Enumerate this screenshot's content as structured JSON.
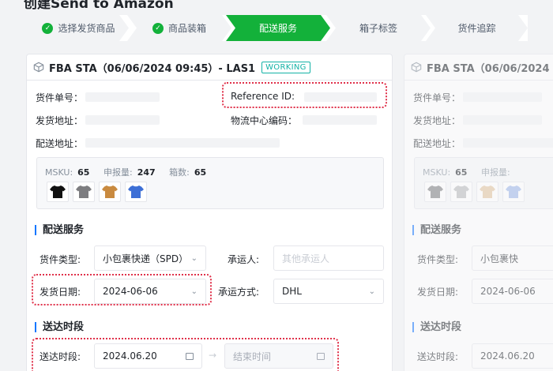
{
  "page": {
    "title": "创建Send to Amazon"
  },
  "steps": [
    {
      "label": "选择发货商品",
      "state": "done"
    },
    {
      "label": "商品装箱",
      "state": "done"
    },
    {
      "label": "配送服务",
      "state": "active"
    },
    {
      "label": "箱子标签",
      "state": "todo"
    },
    {
      "label": "货件追踪",
      "state": "todo"
    }
  ],
  "shipment": {
    "title": "FBA STA（06/06/2024 09:45）- LAS1",
    "status": "WORKING",
    "fields": {
      "shipment_no_label": "货件单号：",
      "reference_id_label": "Reference ID:",
      "ship_from_label": "发货地址：",
      "fc_code_label": "物流中心编码：",
      "ship_to_label": "配送地址："
    },
    "sku_summary": {
      "msku_label": "MSKU:",
      "msku_value": "65",
      "declared_label": "申报量:",
      "declared_value": "247",
      "boxes_label": "箱数:",
      "boxes_value": "65"
    },
    "thumbnails": [
      {
        "name": "tshirt-black-icon",
        "color": "#111111"
      },
      {
        "name": "tshirt-gray-icon",
        "color": "#7d7d80"
      },
      {
        "name": "tshirt-brown-icon",
        "color": "#c98a3f"
      },
      {
        "name": "tshirt-blue-icon",
        "color": "#3d6fd6"
      }
    ],
    "delivery_section": {
      "title": "配送服务",
      "shipment_type_label": "货件类型:",
      "shipment_type_value": "小包裹快递（SPD）",
      "carrier_label": "承运人:",
      "carrier_placeholder": "其他承运人",
      "ship_date_label": "发货日期:",
      "ship_date_value": "2024-06-06",
      "shipping_method_label": "承运方式:",
      "shipping_method_value": "DHL"
    },
    "arrival_section": {
      "title": "送达时段",
      "window_label": "送达时段:",
      "start_value": "2024.06.20",
      "end_placeholder": "结束时间"
    }
  },
  "ghost_card": {
    "title": "FBA STA（06/06/2024",
    "shipment_no_label": "货件单号：",
    "ship_from_label": "发货地址：",
    "ship_to_label": "配送地址：",
    "msku_label": "MSKU:",
    "msku_value": "65",
    "declared_label": "申报量:",
    "thumbnails": [
      {
        "name": "tshirt-gray-icon",
        "color": "#7d7d80"
      },
      {
        "name": "tshirt-lightgray-icon",
        "color": "#b8b9bc"
      },
      {
        "name": "tshirt-beige-icon",
        "color": "#e2c49e"
      },
      {
        "name": "tshirt-lightblue-icon",
        "color": "#9db7ea"
      }
    ],
    "delivery_title": "配送服务",
    "shipment_type_label": "货件类型:",
    "shipment_type_value": "小包裹快",
    "ship_date_label": "发货日期:",
    "ship_date_value": "2024-06-06",
    "arrival_title": "送达时段",
    "window_label": "送达时段:",
    "start_value": "2024.06.20"
  },
  "colors": {
    "accent": "#13b13a",
    "highlight": "#e0324b",
    "badge": "#13b2a6",
    "section_bar": "#1677ff"
  }
}
